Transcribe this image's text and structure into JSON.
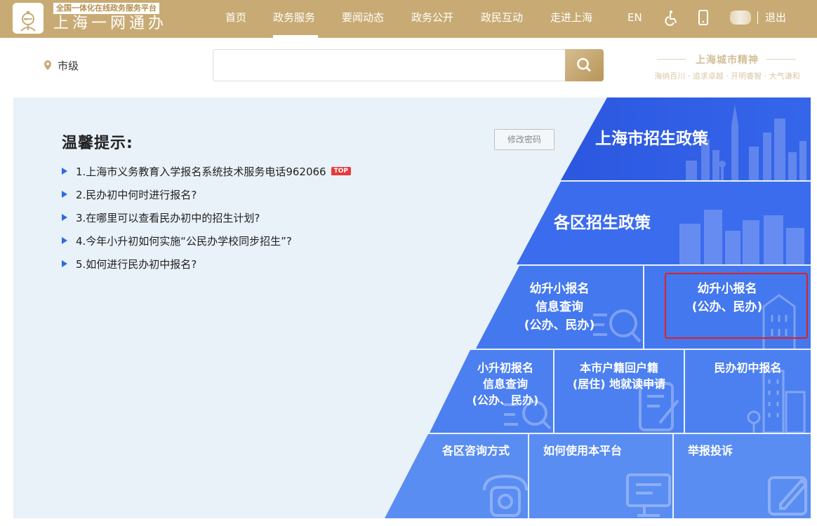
{
  "header": {
    "logo_tag": "全国一体化在线政务服务平台",
    "logo_name": "上海一网通办",
    "nav": [
      {
        "label": "首页",
        "active": false
      },
      {
        "label": "政务服务",
        "active": true
      },
      {
        "label": "要闻动态",
        "active": false
      },
      {
        "label": "政务公开",
        "active": false
      },
      {
        "label": "政民互动",
        "active": false
      },
      {
        "label": "走进上海",
        "active": false
      }
    ],
    "lang": "EN",
    "username": "*",
    "logout": "退出",
    "icons": [
      "accessibility-icon",
      "mobile-icon"
    ]
  },
  "search": {
    "region": "市级",
    "placeholder": "",
    "value": ""
  },
  "spirit": {
    "title": "上海城市精神",
    "subtitle": "海纳百川 · 追求卓越 · 开明睿智 · 大气谦和"
  },
  "tips": {
    "title": "温馨提示:",
    "change_password": "修改密码",
    "items": [
      {
        "text": "1.上海市义务教育入学报名系统技术服务电话962066",
        "badge": "TOP"
      },
      {
        "text": "2.民办初中何时进行报名?"
      },
      {
        "text": "3.在哪里可以查看民办初中的招生计划?"
      },
      {
        "text": "4.今年小升初如何实施“公民办学校同步招生”?"
      },
      {
        "text": "5.如何进行民办初中报名?"
      }
    ]
  },
  "tiles": {
    "city_policy": "上海市招生政策",
    "district_policy": "各区招生政策",
    "kg_query": {
      "l1": "幼升小报名",
      "l2": "信息查询",
      "l3": "(公办、民办)"
    },
    "kg_register": {
      "l1": "幼升小报名",
      "l2": "(公办、民办)"
    },
    "ps_query": {
      "l1": "小升初报名",
      "l2": "信息查询",
      "l3": "(公办、民办)"
    },
    "hukou": {
      "l1": "本市户籍回户籍",
      "l2": "(居住) 地就读申请"
    },
    "private_middle": "民办初中报名",
    "district_contact": "各区咨询方式",
    "how_to_use": "如何使用本平台",
    "report": "举报投诉"
  },
  "colors": {
    "header_gold": "#c8ab74",
    "panel_bg": "#e9f1f9",
    "tile_blue_dark": "#2f62e6",
    "tile_blue": "#3f74ea",
    "tile_blue_light": "#5b8cf0",
    "highlight_red": "#e02020"
  }
}
